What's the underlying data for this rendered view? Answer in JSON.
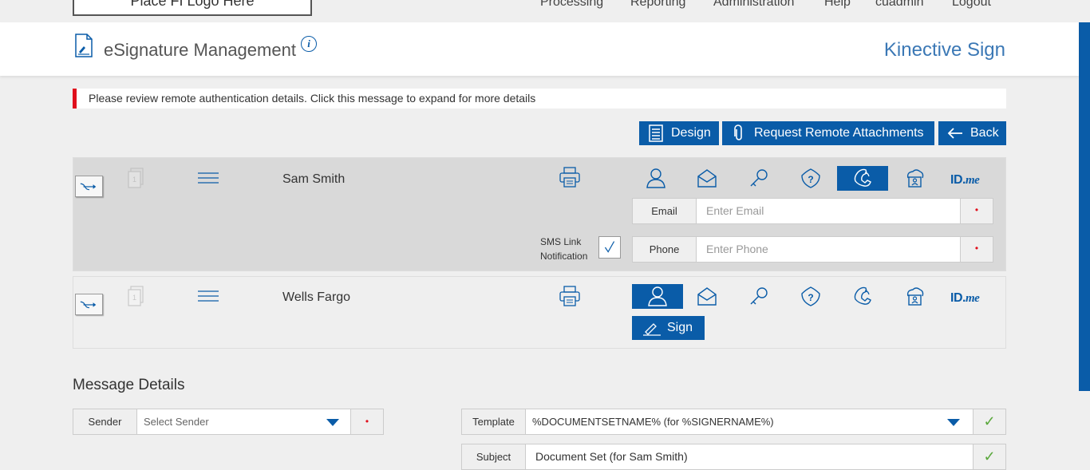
{
  "topnav": {
    "logo_text": "Place FI Logo Here",
    "items": [
      "Processing",
      "Reporting",
      "Administration",
      "Help",
      "cuadmin",
      "Logout"
    ]
  },
  "header": {
    "title": "eSignature Management",
    "info": "i",
    "brand": "Kinective Sign"
  },
  "alert": {
    "text": "Please review remote authentication details. Click this message to expand for more details"
  },
  "actions": {
    "design_label": "Design",
    "remote_label": "Request Remote Attachments",
    "back_label": "Back"
  },
  "signers": [
    {
      "doc_number": "1",
      "name": "Sam Smith",
      "active_auth": "phone",
      "sms_label_line1": "SMS Link",
      "sms_label_line2": "Notification",
      "email_label": "Email",
      "email_placeholder": "Enter Email",
      "phone_label": "Phone",
      "phone_placeholder": "Enter Phone",
      "required_mark": "•"
    },
    {
      "doc_number": "1",
      "name": "Wells Fargo",
      "active_auth": "in-person",
      "sign_label": "Sign"
    }
  ],
  "auth_methods": [
    "in-person-user-icon",
    "email-icon",
    "key-icon",
    "security-question-icon",
    "phone-icon",
    "cloud-id-icon",
    "idme-logo"
  ],
  "idme": {
    "id": "ID.",
    "me": "me"
  },
  "message_details": {
    "title": "Message Details",
    "sender_label": "Sender",
    "sender_placeholder": "Select Sender",
    "template_label": "Template",
    "template_value": "%DOCUMENTSETNAME% (for %SIGNERNAME%)",
    "subject_label": "Subject",
    "subject_value": "Document Set (for Sam Smith)",
    "required_mark": "•",
    "check_mark": "✓"
  },
  "colors": {
    "accent": "#0a5ca8",
    "alert": "#e0101c",
    "brand_text": "#3b78b5",
    "check": "#5aa83c"
  }
}
